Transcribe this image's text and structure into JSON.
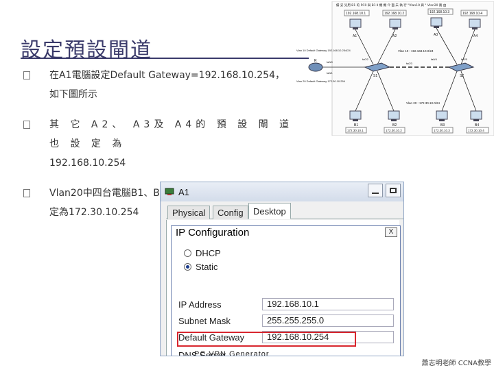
{
  "slide": {
    "title": "設定預設閘道",
    "bullets": [
      {
        "line1": "在A1電腦設定Default Gateway=192.168.10.254，",
        "line2": "如下圖所示"
      },
      {
        "line1": "其 它 A2、 A3及 A4的 預 設 閘 道 也 設 定 為",
        "line2": "192.168.10.254"
      },
      {
        "line1": "Vlan20中四台電腦B1、B2、B3及B4的預設閘道設",
        "line2": "定為172.30.10.254"
      }
    ],
    "credit": "蕭志明老師 CCNA教學"
  },
  "topology": {
    "caption": "備 妥 兒用 B1  的 PC0 與 B1 Ⅱ 機 機  介 面 未 執 行 \"Vlan10 與 \" Vlan20 路 由",
    "pcs_top": [
      {
        "name": "A1",
        "ip": "192.168.10.1"
      },
      {
        "name": "A2",
        "ip": "192.168.10.2"
      },
      {
        "name": "A3",
        "ip": "192.168.10.3"
      },
      {
        "name": "A4",
        "ip": "192.168.10.4"
      }
    ],
    "pcs_bottom": [
      {
        "name": "B1",
        "ip": "172.30.10.1"
      },
      {
        "name": "B2",
        "ip": "172.30.10.2"
      },
      {
        "name": "B3",
        "ip": "172.30.10.3"
      },
      {
        "name": "B4",
        "ip": "172.30.10.4"
      }
    ],
    "vlan10_gw": "Vlan 10 Default Gateway 192.168.10.254/24",
    "vlan20_gw": "Vlan 20 Default Gateway 172.30.10.254",
    "vlan10_label": "Vlan 10 : 192.168.10.0/24",
    "vlan20_label": "Vlan 20 : 172.30.10.0/24",
    "router_label": "R",
    "switch_labels": [
      "S1",
      "S2"
    ],
    "ports": [
      "fa0/0",
      "fa0/1",
      "fa0/2",
      "fa0/3",
      "fa0/4",
      "fa0/5"
    ]
  },
  "pt_window": {
    "title": "A1",
    "tabs": [
      {
        "label": "Physical"
      },
      {
        "label": "Config"
      },
      {
        "label": "Desktop"
      }
    ],
    "dialog": {
      "title": "IP Configuration",
      "close": "X",
      "dhcp_label": "DHCP",
      "static_label": "Static",
      "ip_label": "IP Address",
      "ip_value": "192.168.10.1",
      "mask_label": "Subnet Mask",
      "mask_value": "255.255.255.0",
      "gw_label": "Default Gateway",
      "gw_value": "192.168.10.254",
      "dns_label": "DNS Server",
      "dns_value": ""
    },
    "cutoff": "PC          VPN        Generator"
  },
  "colors": {
    "title": "#3a3a6a",
    "highlight": "#d8262e",
    "radio_checked": "#1c3c8c"
  }
}
